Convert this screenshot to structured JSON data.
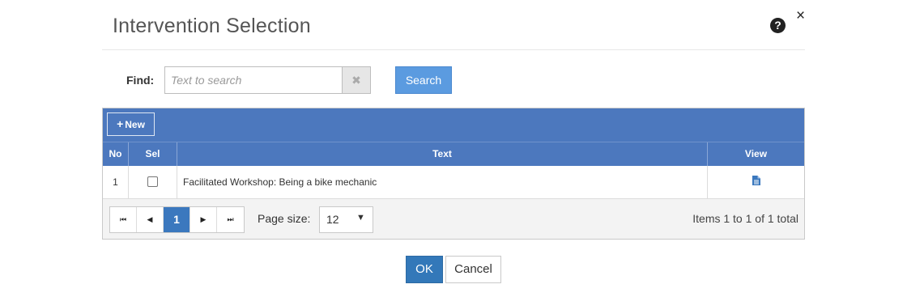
{
  "dialog": {
    "title": "Intervention Selection",
    "help_glyph": "?",
    "close_glyph": "×"
  },
  "search": {
    "label": "Find:",
    "value": "",
    "placeholder": "Text to search",
    "clear_glyph": "✖",
    "button_label": "Search"
  },
  "grid": {
    "new_button": {
      "icon": "plus-icon",
      "glyph": "+",
      "label": "New"
    },
    "columns": [
      "No",
      "Sel",
      "Text",
      "View"
    ],
    "rows": [
      {
        "no": "1",
        "selected": false,
        "text": "Facilitated Workshop: Being a bike mechanic",
        "view_icon": "document-icon"
      }
    ]
  },
  "pager": {
    "first_glyph": "⏮",
    "prev_glyph": "◀",
    "current_page": "1",
    "next_glyph": "▶",
    "last_glyph": "⏭",
    "page_size_label": "Page size:",
    "page_size_value": "12",
    "page_size_caret": "▼",
    "items_info": "Items 1 to 1 of 1 total"
  },
  "footer": {
    "ok_label": "OK",
    "cancel_label": "Cancel"
  },
  "colors": {
    "grid_header": "#4c78be",
    "primary_button": "#3378b9",
    "search_button": "#5b9be0",
    "view_icon": "#3b78be"
  }
}
